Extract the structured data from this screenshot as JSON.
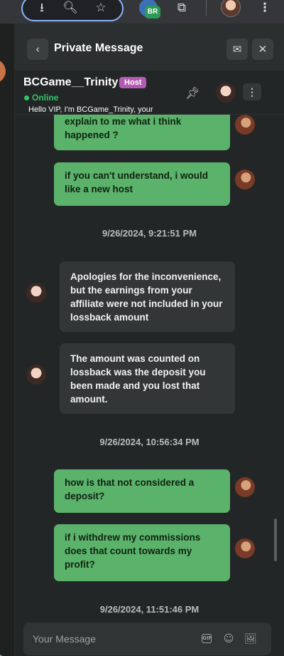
{
  "browser": {
    "profile_initials": "BR",
    "icons": [
      "download-icon",
      "zoom-icon",
      "star-icon",
      "extensions-icon",
      "more-icon"
    ]
  },
  "topbar": {
    "title": "Private Message"
  },
  "header": {
    "host_name": "BCGame__Trinity",
    "host_badge": "Host",
    "status": "Online",
    "welcome": "Hello VIP, I'm BCGame_Trinity, your"
  },
  "messages": [
    {
      "type": "out",
      "text": "explain to me what i think happened ?"
    },
    {
      "type": "out",
      "text": "if you can't understand, i would like a new host"
    },
    {
      "type": "time",
      "text": "9/26/2024, 9:21:51 PM"
    },
    {
      "type": "in",
      "text": "Apologies for the inconvenience, but the earnings from your affiliate were not included in your lossback amount"
    },
    {
      "type": "in",
      "text": "The amount was counted on lossback was the deposit you been made and you lost that amount."
    },
    {
      "type": "time",
      "text": "9/26/2024, 10:56:34 PM"
    },
    {
      "type": "out",
      "text": "how is that not considered a deposit?"
    },
    {
      "type": "out",
      "text": "if i withdrew my commissions does that count towards my profit?"
    },
    {
      "type": "time",
      "text": "9/26/2024, 11:51:46 PM"
    }
  ],
  "composer": {
    "placeholder": "Your Message",
    "gif_label": "GIF"
  },
  "colors": {
    "outgoing": "#5bb26b",
    "incoming": "#323636",
    "online": "#35c46a",
    "host_badge": "#b45ab4"
  }
}
